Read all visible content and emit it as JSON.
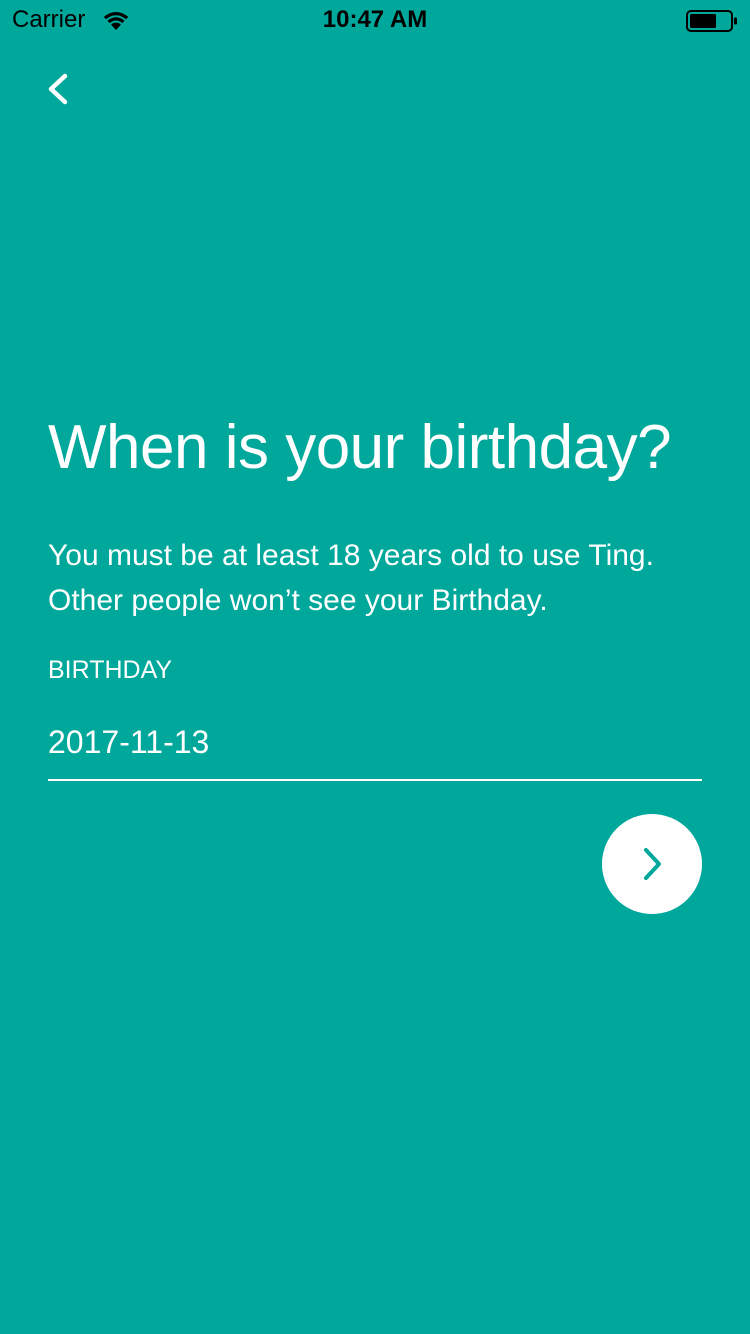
{
  "status_bar": {
    "carrier": "Carrier",
    "time": "10:47 AM"
  },
  "colors": {
    "background": "#00A79B",
    "foreground": "#FFFFFF",
    "next_chevron": "#00A79B"
  },
  "icons": {
    "back": "chevron-left-icon",
    "next": "chevron-right-icon",
    "wifi": "wifi-icon",
    "battery": "battery-icon"
  },
  "screen": {
    "title": "When is your birthday?",
    "subtitle": "You must be at least 18 years old to use Ting. Other people won’t see your Birthday.",
    "birthday_field": {
      "label": "BIRTHDAY",
      "value": "2017-11-13"
    }
  }
}
